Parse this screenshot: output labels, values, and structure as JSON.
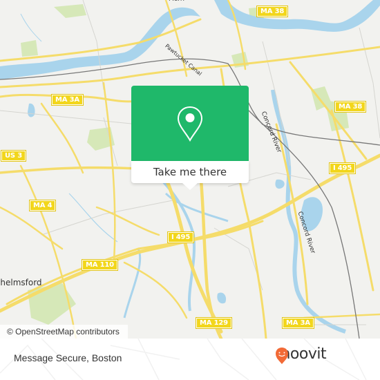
{
  "map": {
    "route_shields": [
      {
        "id": "ma38-top",
        "label": "MA 38"
      },
      {
        "id": "ma38-right",
        "label": "MA 38"
      },
      {
        "id": "ma3a-left",
        "label": "MA 3A"
      },
      {
        "id": "us3",
        "label": "US 3"
      },
      {
        "id": "i495-right",
        "label": "I 495"
      },
      {
        "id": "ma4",
        "label": "MA 4"
      },
      {
        "id": "i495-center",
        "label": "I 495"
      },
      {
        "id": "ma110",
        "label": "MA 110"
      },
      {
        "id": "ma129",
        "label": "MA 129"
      },
      {
        "id": "ma3a-bottom",
        "label": "MA 3A"
      }
    ],
    "labels": {
      "concord_river_1": "Concord River",
      "concord_river_2": "Concord River",
      "pawtucket_canal": "Pawtucket Canal",
      "chelmsford": "Chelmsford",
      "merrimack": "Merri"
    },
    "colors": {
      "land": "#f2f2ef",
      "water": "#a9d4ec",
      "road": "#f5dc6a",
      "park": "#d6e8b8",
      "rail": "#777777"
    }
  },
  "popup": {
    "icon": "map-pin-icon",
    "button_label": "Take me there",
    "color": "#1fb86a"
  },
  "attribution": "© OpenStreetMap contributors",
  "footer": {
    "place_name": "Message Secure, Boston",
    "brand": "moovit",
    "brand_color": "#f26a36"
  }
}
